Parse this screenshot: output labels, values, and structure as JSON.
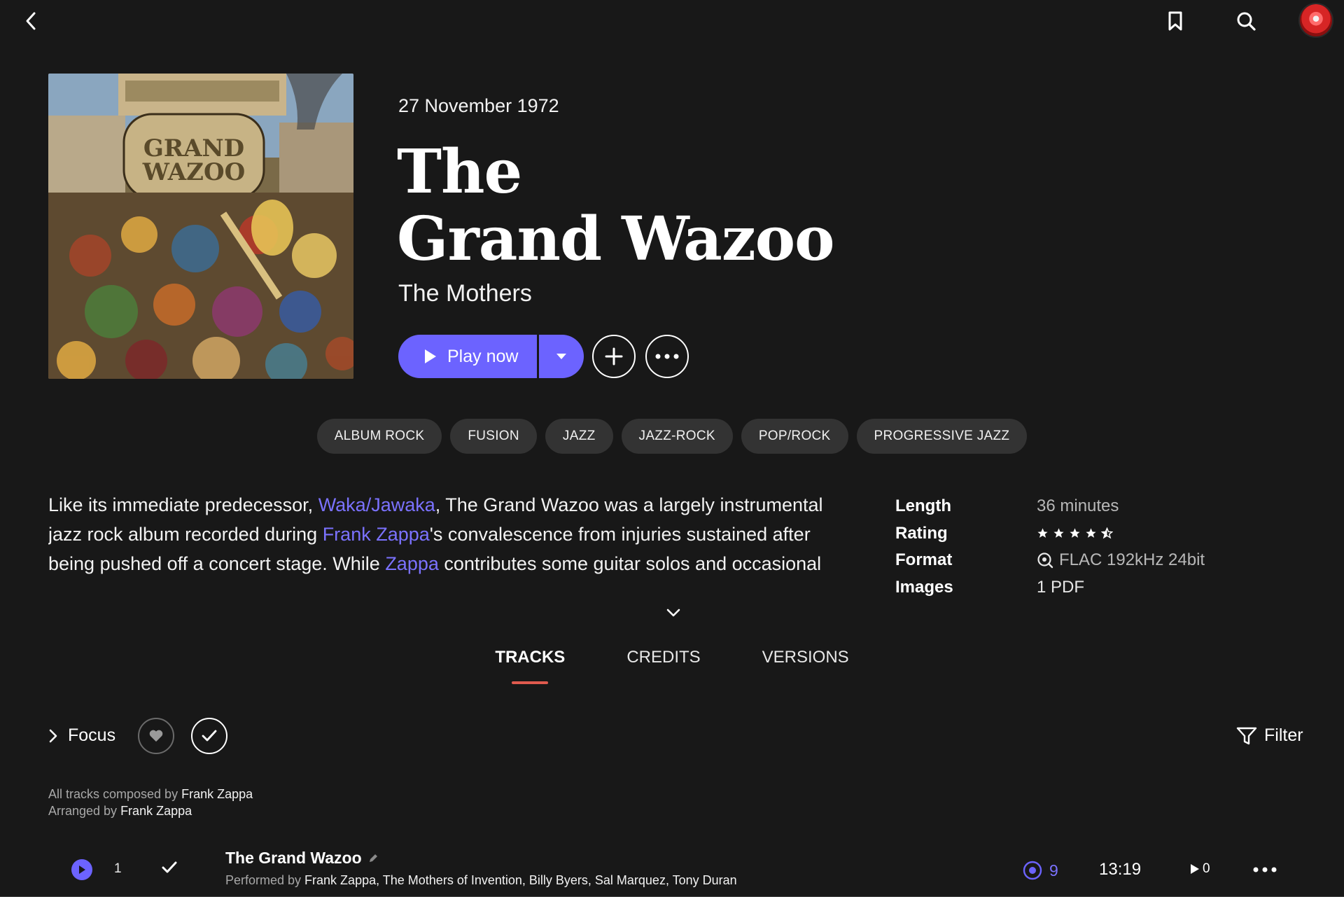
{
  "album": {
    "release_date": "27 November 1972",
    "title_line1": "The",
    "title_line2": "Grand Wazoo",
    "artist": "The Mothers",
    "play_label": "Play now"
  },
  "genres": [
    "ALBUM ROCK",
    "FUSION",
    "JAZZ",
    "JAZZ-ROCK",
    "POP/ROCK",
    "PROGRESSIVE JAZZ"
  ],
  "description": {
    "p1": "Like its immediate predecessor, ",
    "link1": "Waka/Jawaka",
    "p2": ", The Grand Wazoo was a largely instrumental jazz rock album recorded during ",
    "link2": "Frank Zappa",
    "p3": "'s convalescence from injuries sustained after being pushed off a concert stage. While ",
    "link3": "Zappa",
    "p4": " contributes some guitar solos and occasional vocals, the"
  },
  "meta": {
    "length_key": "Length",
    "length_val": "36 minutes",
    "rating_key": "Rating",
    "rating_value": 4.5,
    "format_key": "Format",
    "format_val": "FLAC 192kHz 24bit",
    "images_key": "Images",
    "images_val": "1 PDF"
  },
  "tabs": [
    "TRACKS",
    "CREDITS",
    "VERSIONS"
  ],
  "tracks_header": {
    "focus_label": "Focus",
    "filter_label": "Filter",
    "composed_prefix": "All tracks composed by ",
    "composed_by": "Frank Zappa",
    "arranged_prefix": "Arranged by ",
    "arranged_by": "Frank Zappa"
  },
  "track": {
    "number": "1",
    "title": "The Grand Wazoo",
    "performed_prefix": "Performed by ",
    "performers": "Frank Zappa, The Mothers of Invention, Billy Byers, Sal Marquez, Tony Duran",
    "hires_count": "9",
    "duration": "13:19",
    "plays": "0"
  },
  "colors": {
    "accent": "#6c63ff",
    "tab_underline": "#e05a4e",
    "background": "#181818"
  },
  "icons": [
    "back-arrow-icon",
    "bookmark-icon",
    "search-icon",
    "play-icon",
    "caret-down-icon",
    "plus-icon",
    "more-icon",
    "star-icon",
    "hires-badge-icon",
    "chevron-down-icon",
    "chevron-right-icon",
    "heart-icon",
    "check-icon",
    "filter-icon",
    "pencil-icon",
    "hires-disc-icon"
  ]
}
